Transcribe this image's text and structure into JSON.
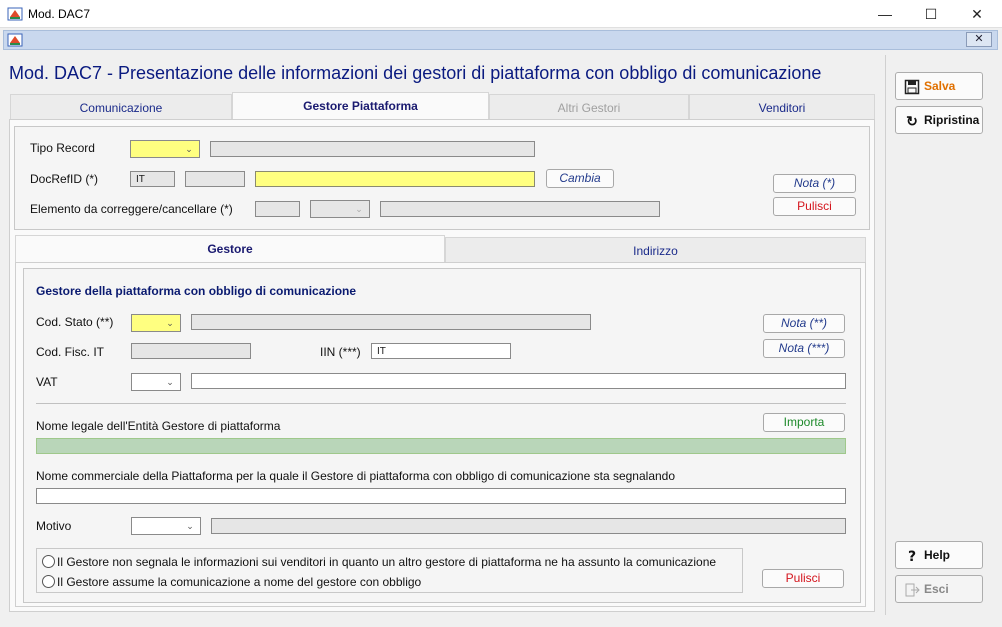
{
  "window": {
    "title": "Mod. DAC7",
    "minimize": "—",
    "maximize": "☐",
    "close": "✕"
  },
  "mdi": {
    "close": "✕"
  },
  "page": {
    "title": "Mod. DAC7 - Presentazione delle informazioni dei gestori di piattaforma con obbligo di comunicazione"
  },
  "tabs": [
    "Comunicazione",
    "Gestore Piattaforma",
    "Altri Gestori",
    "Venditori"
  ],
  "record": {
    "tipo_record_label": "Tipo Record",
    "docrefid_label": "DocRefID (*)",
    "docrefid_country": "IT",
    "cambia_label": "Cambia",
    "nota_label": "Nota (*)",
    "elemento_label": "Elemento da correggere/cancellare (*)",
    "pulisci_label": "Pulisci"
  },
  "subtabs": [
    "Gestore",
    "Indirizzo"
  ],
  "gestore": {
    "section_title": "Gestore della piattaforma con obbligo di comunicazione",
    "cod_stato_label": "Cod. Stato (**)",
    "nota2_label": "Nota (**)",
    "cod_fisc_label": "Cod. Fisc. IT",
    "iin_label": "IIN (***)",
    "iin_value": "IT",
    "nota3_label": "Nota (***)",
    "vat_label": "VAT",
    "nome_legale_label": "Nome legale dell'Entità Gestore di piattaforma",
    "importa_label": "Importa",
    "nome_commerciale_label": "Nome commerciale della Piattaforma per la quale il Gestore di piattaforma con obbligo di comunicazione sta segnalando",
    "motivo_label": "Motivo",
    "radio1": "Il Gestore non segnala le informazioni sui venditori in quanto un altro gestore di piattaforma ne ha assunto la comunicazione",
    "radio2": "Il Gestore assume la comunicazione a nome del gestore con obbligo",
    "pulisci_label": "Pulisci"
  },
  "side": {
    "salva": "Salva",
    "ripristina": "Ripristina",
    "help": "Help",
    "esci": "Esci"
  },
  "colors": {
    "title_blue": "#0a1a80",
    "yellow_field": "#ffff80",
    "green_field": "#b9d6b9",
    "red_text": "#d4141c",
    "orange_text": "#e07000"
  }
}
